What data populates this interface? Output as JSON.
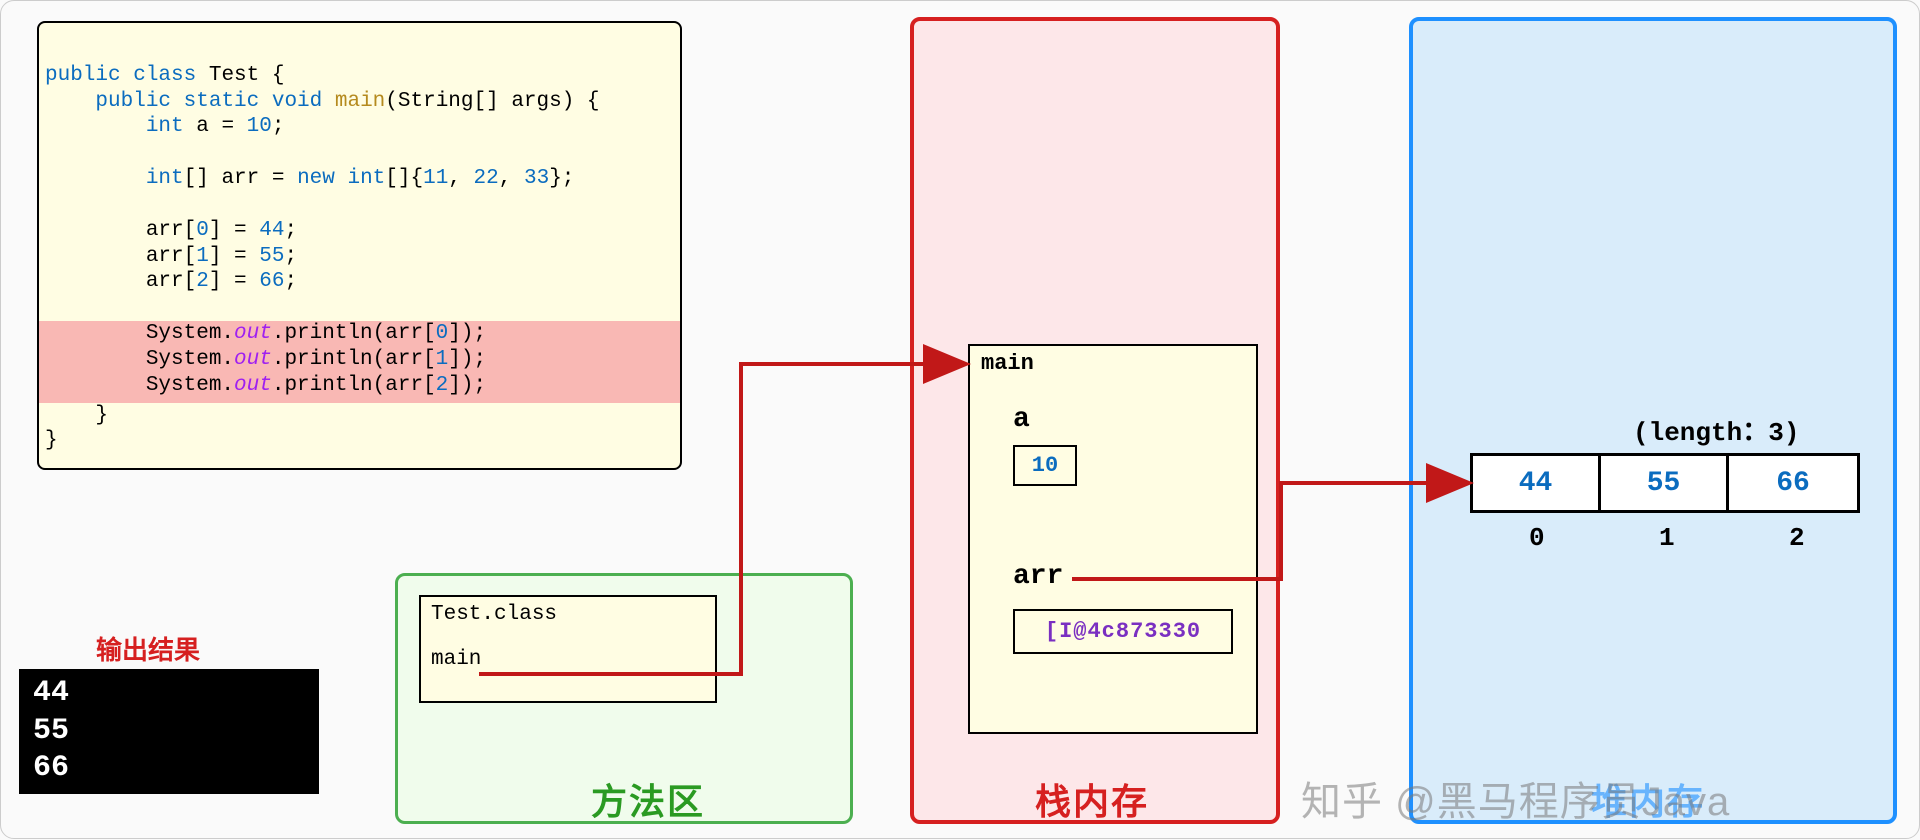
{
  "code": {
    "class_name": "Test",
    "method_name": "main",
    "args_sig": "String[] args",
    "var_a": "a",
    "val_a": "10",
    "arr_decl_left": "int[] arr = ",
    "arr_init": "int[]{11, 22, 33}",
    "assign0": "arr[0] = 44;",
    "assign1": "arr[1] = 55;",
    "assign2": "arr[2] = 66;",
    "print0": "System.out.println(arr[0]);",
    "print1": "System.out.println(arr[1]);",
    "print2": "System.out.println(arr[2]);"
  },
  "output_label": "输出结果",
  "console": {
    "line0": "44",
    "line1": "55",
    "line2": "66"
  },
  "method_area": {
    "label": "方法区",
    "class_file": "Test.class",
    "method": "main"
  },
  "stack": {
    "label": "栈内存",
    "frame_name": "main",
    "var_a_name": "a",
    "var_a_val": "10",
    "var_arr_name": "arr",
    "var_arr_val": "[I@4c873330"
  },
  "heap": {
    "label": "堆内存",
    "length_label": "(length：3)",
    "cells": [
      "44",
      "55",
      "66"
    ],
    "indices": [
      "0",
      "1",
      "2"
    ]
  },
  "watermark": "知乎 @黑马程序员Java"
}
